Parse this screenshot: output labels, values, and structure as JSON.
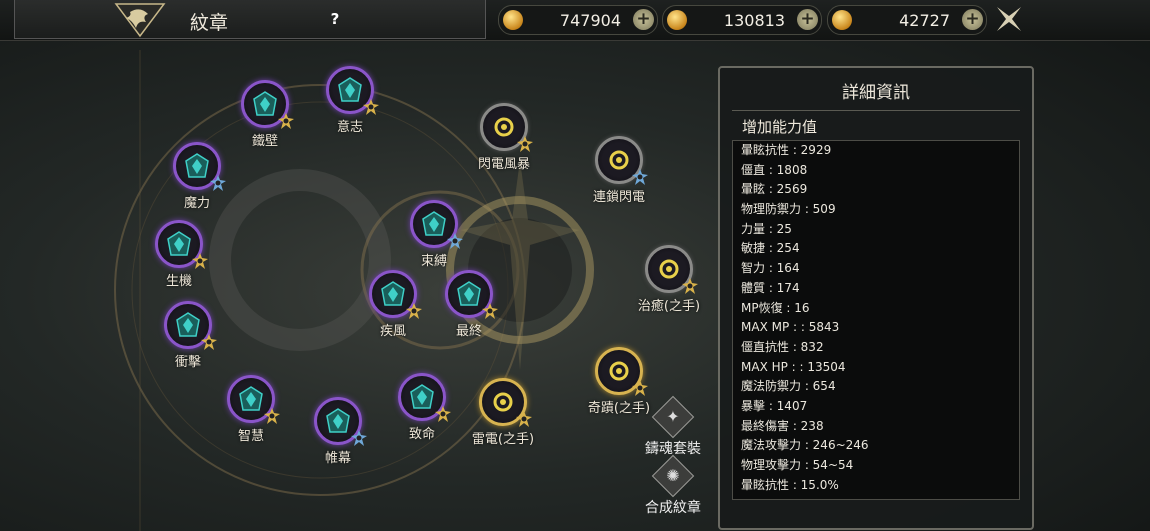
{
  "header": {
    "title": "紋章",
    "help_label": "?",
    "currencies": [
      {
        "name": "refresh-currency",
        "value": "747904"
      },
      {
        "name": "gold-pouch-currency",
        "value": "130813"
      },
      {
        "name": "coin-currency",
        "value": "42727"
      }
    ],
    "plus_label": "+"
  },
  "emblems": [
    {
      "id": "tiebi",
      "label": "鐵壁",
      "ring": "purple",
      "badge": "gold",
      "gem": "teal"
    },
    {
      "id": "yizhi",
      "label": "意志",
      "ring": "purple",
      "badge": "gold",
      "gem": "teal"
    },
    {
      "id": "moli",
      "label": "魔力",
      "ring": "purple",
      "badge": "blue",
      "gem": "teal"
    },
    {
      "id": "shengji",
      "label": "生機",
      "ring": "purple",
      "badge": "gold",
      "gem": "teal"
    },
    {
      "id": "chongji",
      "label": "衝擊",
      "ring": "purple",
      "badge": "gold",
      "gem": "teal"
    },
    {
      "id": "zhihui",
      "label": "智慧",
      "ring": "purple",
      "badge": "gold",
      "gem": "teal"
    },
    {
      "id": "weimu",
      "label": "帷幕",
      "ring": "purple",
      "badge": "blue",
      "gem": "teal"
    },
    {
      "id": "zhiming",
      "label": "致命",
      "ring": "purple",
      "badge": "gold",
      "gem": "teal"
    },
    {
      "id": "shufu",
      "label": "束縛",
      "ring": "purple",
      "badge": "blue",
      "gem": "teal"
    },
    {
      "id": "jifeng",
      "label": "疾風",
      "ring": "purple",
      "badge": "gold",
      "gem": "teal"
    },
    {
      "id": "zuizhong",
      "label": "最終",
      "ring": "purple",
      "badge": "gold",
      "gem": "teal"
    },
    {
      "id": "shandian",
      "label": "閃電風暴",
      "ring": "grey",
      "badge": "gold",
      "gem": "yellow"
    },
    {
      "id": "liansuo",
      "label": "連鎖閃電",
      "ring": "grey",
      "badge": "blue",
      "gem": "yellow"
    },
    {
      "id": "zhiyu",
      "label": "治癒(之手)",
      "ring": "grey",
      "badge": "gold",
      "gem": "yellow"
    },
    {
      "id": "qiji",
      "label": "奇蹟(之手)",
      "ring": "gold",
      "badge": "gold",
      "gem": "yellow"
    },
    {
      "id": "leidian",
      "label": "雷電(之手)",
      "ring": "gold",
      "badge": "gold",
      "gem": "yellow"
    }
  ],
  "side_buttons": {
    "set": "鑄魂套裝",
    "craft": "合成紋章"
  },
  "detail_panel": {
    "title": "詳細資訊",
    "subtitle": "增加能力值",
    "stats": [
      "暈眩抗性 : 2929",
      "僵直 : 1808",
      "暈眩 : 2569",
      "物理防禦力 : 509",
      "力量 : 25",
      "敏捷 : 254",
      "智力 : 164",
      "體質 : 174",
      "MP恢復 : 16",
      "MAX MP :   : 5843",
      "僵直抗性 : 832",
      "MAX HP :   : 13504",
      "魔法防禦力 : 654",
      "暴擊 : 1407",
      "最終傷害 : 238",
      "魔法攻擊力 : 246~246",
      "物理攻擊力 : 54~54",
      "暈眩抗性 : 15.0%"
    ]
  },
  "colors": {
    "purple_ring": "#8a55c9",
    "gold_ring": "#d7b350",
    "teal_gem": "#3fd0c8",
    "yellow_gem": "#e8d04a",
    "badge_gold": "#d9b24a",
    "badge_blue": "#6fa8d8"
  }
}
